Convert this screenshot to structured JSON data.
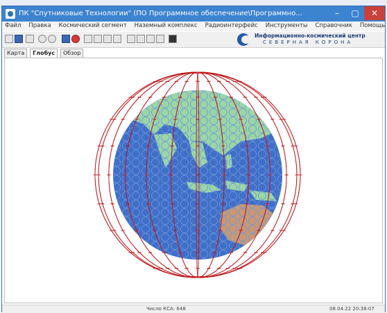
{
  "window": {
    "title": "ПК \"Спутниковые Технологии\" (ПО Программное обеспечение\\Программно...",
    "controls": {
      "minimize": "–",
      "maximize": "▢",
      "close": "✕"
    }
  },
  "menu": {
    "items": [
      "Файл",
      "Правка",
      "Космический сегмент",
      "Наземный комплекс",
      "Радиоинтерфейс",
      "Инструменты",
      "Справочник",
      "Помощь"
    ]
  },
  "logo": {
    "line1": "Информационно-космический центр",
    "line2": "СЕВЕРНАЯ КОРОНА"
  },
  "tabs": [
    {
      "label": "Карта",
      "active": false
    },
    {
      "label": "Глобус",
      "active": true
    },
    {
      "label": "Обзор",
      "active": false
    }
  ],
  "status": {
    "center": "Число КСА: 648",
    "right": "08.04.22 20:38:07"
  },
  "colors": {
    "titlebar": "#3c83d0",
    "ocean": "#3f6fc8",
    "land": "#9bd6a6",
    "australia": "#c99873",
    "orbits": "#c0171b"
  },
  "icons": {
    "app": "app-logo-icon",
    "logo": "crescent-logo-icon"
  }
}
